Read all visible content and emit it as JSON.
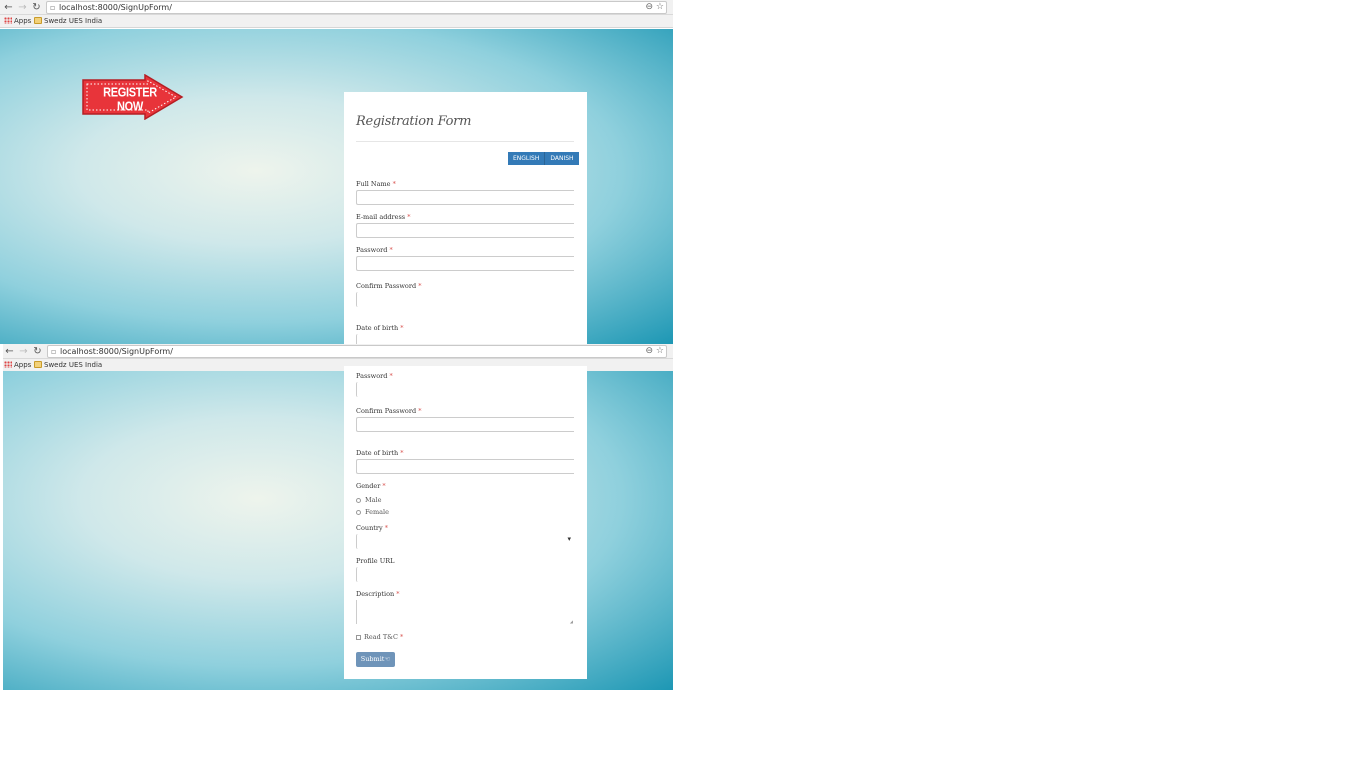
{
  "browser": {
    "url": "localhost:8000/SignUpForm/",
    "bookmarks": [
      {
        "label": "Apps"
      },
      {
        "label": "Swedz UES India"
      }
    ]
  },
  "banner": {
    "text": "REGISTER NOW",
    "color": "#e8343a"
  },
  "form": {
    "title": "Registration Form",
    "languages": [
      "ENGLISH",
      "DANISH"
    ],
    "required_mark": "*",
    "fields": {
      "full_name": "Full Name",
      "email": "E-mail address",
      "password": "Password",
      "confirm_password": "Confirm Password",
      "dob": "Date of birth",
      "gender": "Gender",
      "country": "Country",
      "profile_url": "Profile URL",
      "description": "Description"
    },
    "gender_options": [
      "Male",
      "Female"
    ],
    "terms_label": "Read T&C",
    "submit_label": "Submit",
    "submit_icon": "hand-pointer-icon",
    "accent_color": "#337ab7"
  }
}
